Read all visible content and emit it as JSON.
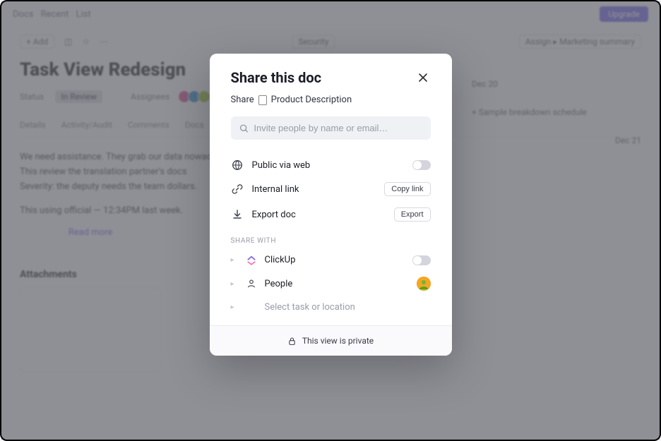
{
  "background": {
    "topbar": {
      "tab1": "Docs",
      "tab2": "Recent",
      "tab3": "List"
    },
    "toolbar": {
      "btn1": "+ Add",
      "center_pill": "Security",
      "right_pill": "Assign ▸ Marketing summary"
    },
    "title": "Task View Redesign",
    "meta": {
      "status_label": "Status",
      "status_value": "In Review",
      "assignee_label": "Assignees"
    },
    "tabs": [
      "Details",
      "Activity/Audit",
      "Comments",
      "Docs"
    ],
    "body_line1": "We need assistance. They grab our data nowadays",
    "body_line2": "This review the translation partner's docs",
    "body_line3": "Severity: the deputy needs the team dollars.",
    "body_line4": "This using official — 12:34PM last week.",
    "readmore": "Read more",
    "section_heading": "Attachments",
    "right": {
      "d1": "Dec 20",
      "d2": "+ Sample breakdown schedule",
      "d3": "Dec 21"
    }
  },
  "modal": {
    "title": "Share this doc",
    "sub_prefix": "Share",
    "sub_docname": "Product Description",
    "search_placeholder": "Invite people by name or email…",
    "options": {
      "public": {
        "label": "Public via web"
      },
      "internal": {
        "label": "Internal link",
        "action": "Copy link"
      },
      "export": {
        "label": "Export doc",
        "action": "Export"
      }
    },
    "share_with_label": "SHARE WITH",
    "share_items": {
      "clickup": "ClickUp",
      "people": "People",
      "select": "Select task or location"
    },
    "footer": "This view is private"
  }
}
